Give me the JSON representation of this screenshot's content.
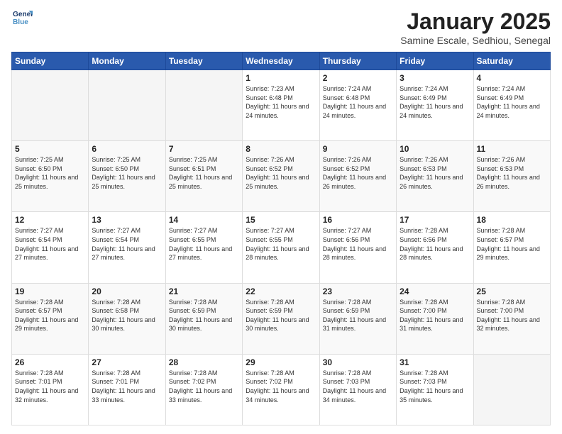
{
  "logo": {
    "line1": "General",
    "line2": "Blue"
  },
  "header": {
    "month": "January 2025",
    "location": "Samine Escale, Sedhiou, Senegal"
  },
  "weekdays": [
    "Sunday",
    "Monday",
    "Tuesday",
    "Wednesday",
    "Thursday",
    "Friday",
    "Saturday"
  ],
  "weeks": [
    [
      {
        "day": "",
        "info": ""
      },
      {
        "day": "",
        "info": ""
      },
      {
        "day": "",
        "info": ""
      },
      {
        "day": "1",
        "info": "Sunrise: 7:23 AM\nSunset: 6:48 PM\nDaylight: 11 hours and 24 minutes."
      },
      {
        "day": "2",
        "info": "Sunrise: 7:24 AM\nSunset: 6:48 PM\nDaylight: 11 hours and 24 minutes."
      },
      {
        "day": "3",
        "info": "Sunrise: 7:24 AM\nSunset: 6:49 PM\nDaylight: 11 hours and 24 minutes."
      },
      {
        "day": "4",
        "info": "Sunrise: 7:24 AM\nSunset: 6:49 PM\nDaylight: 11 hours and 24 minutes."
      }
    ],
    [
      {
        "day": "5",
        "info": "Sunrise: 7:25 AM\nSunset: 6:50 PM\nDaylight: 11 hours and 25 minutes."
      },
      {
        "day": "6",
        "info": "Sunrise: 7:25 AM\nSunset: 6:50 PM\nDaylight: 11 hours and 25 minutes."
      },
      {
        "day": "7",
        "info": "Sunrise: 7:25 AM\nSunset: 6:51 PM\nDaylight: 11 hours and 25 minutes."
      },
      {
        "day": "8",
        "info": "Sunrise: 7:26 AM\nSunset: 6:52 PM\nDaylight: 11 hours and 25 minutes."
      },
      {
        "day": "9",
        "info": "Sunrise: 7:26 AM\nSunset: 6:52 PM\nDaylight: 11 hours and 26 minutes."
      },
      {
        "day": "10",
        "info": "Sunrise: 7:26 AM\nSunset: 6:53 PM\nDaylight: 11 hours and 26 minutes."
      },
      {
        "day": "11",
        "info": "Sunrise: 7:26 AM\nSunset: 6:53 PM\nDaylight: 11 hours and 26 minutes."
      }
    ],
    [
      {
        "day": "12",
        "info": "Sunrise: 7:27 AM\nSunset: 6:54 PM\nDaylight: 11 hours and 27 minutes."
      },
      {
        "day": "13",
        "info": "Sunrise: 7:27 AM\nSunset: 6:54 PM\nDaylight: 11 hours and 27 minutes."
      },
      {
        "day": "14",
        "info": "Sunrise: 7:27 AM\nSunset: 6:55 PM\nDaylight: 11 hours and 27 minutes."
      },
      {
        "day": "15",
        "info": "Sunrise: 7:27 AM\nSunset: 6:55 PM\nDaylight: 11 hours and 28 minutes."
      },
      {
        "day": "16",
        "info": "Sunrise: 7:27 AM\nSunset: 6:56 PM\nDaylight: 11 hours and 28 minutes."
      },
      {
        "day": "17",
        "info": "Sunrise: 7:28 AM\nSunset: 6:56 PM\nDaylight: 11 hours and 28 minutes."
      },
      {
        "day": "18",
        "info": "Sunrise: 7:28 AM\nSunset: 6:57 PM\nDaylight: 11 hours and 29 minutes."
      }
    ],
    [
      {
        "day": "19",
        "info": "Sunrise: 7:28 AM\nSunset: 6:57 PM\nDaylight: 11 hours and 29 minutes."
      },
      {
        "day": "20",
        "info": "Sunrise: 7:28 AM\nSunset: 6:58 PM\nDaylight: 11 hours and 30 minutes."
      },
      {
        "day": "21",
        "info": "Sunrise: 7:28 AM\nSunset: 6:59 PM\nDaylight: 11 hours and 30 minutes."
      },
      {
        "day": "22",
        "info": "Sunrise: 7:28 AM\nSunset: 6:59 PM\nDaylight: 11 hours and 30 minutes."
      },
      {
        "day": "23",
        "info": "Sunrise: 7:28 AM\nSunset: 6:59 PM\nDaylight: 11 hours and 31 minutes."
      },
      {
        "day": "24",
        "info": "Sunrise: 7:28 AM\nSunset: 7:00 PM\nDaylight: 11 hours and 31 minutes."
      },
      {
        "day": "25",
        "info": "Sunrise: 7:28 AM\nSunset: 7:00 PM\nDaylight: 11 hours and 32 minutes."
      }
    ],
    [
      {
        "day": "26",
        "info": "Sunrise: 7:28 AM\nSunset: 7:01 PM\nDaylight: 11 hours and 32 minutes."
      },
      {
        "day": "27",
        "info": "Sunrise: 7:28 AM\nSunset: 7:01 PM\nDaylight: 11 hours and 33 minutes."
      },
      {
        "day": "28",
        "info": "Sunrise: 7:28 AM\nSunset: 7:02 PM\nDaylight: 11 hours and 33 minutes."
      },
      {
        "day": "29",
        "info": "Sunrise: 7:28 AM\nSunset: 7:02 PM\nDaylight: 11 hours and 34 minutes."
      },
      {
        "day": "30",
        "info": "Sunrise: 7:28 AM\nSunset: 7:03 PM\nDaylight: 11 hours and 34 minutes."
      },
      {
        "day": "31",
        "info": "Sunrise: 7:28 AM\nSunset: 7:03 PM\nDaylight: 11 hours and 35 minutes."
      },
      {
        "day": "",
        "info": ""
      }
    ]
  ]
}
